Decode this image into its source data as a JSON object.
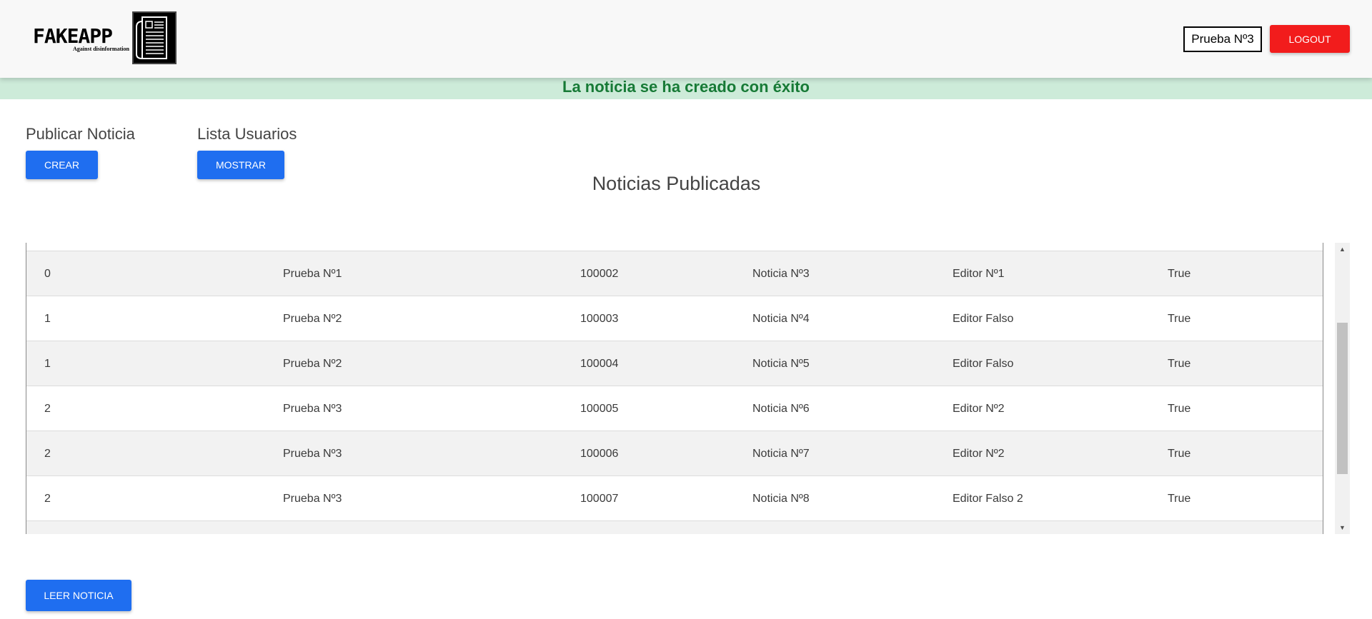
{
  "header": {
    "logo_text": "FAKEAPP",
    "logo_tagline": "Against disinformation",
    "user_name": "Prueba Nº3",
    "logout_label": "LOGOUT"
  },
  "flash_message": "La noticia se ha creado con éxito",
  "publish": {
    "label": "Publicar Noticia",
    "button": "CREAR"
  },
  "users": {
    "label": "Lista Usuarios",
    "button": "MOSTRAR"
  },
  "page_title": "Noticias Publicadas",
  "table": {
    "rows": [
      [
        "0",
        "Prueba Nº1",
        "100002",
        "Noticia Nº3",
        "Editor Nº1",
        "True"
      ],
      [
        "1",
        "Prueba Nº2",
        "100003",
        "Noticia Nº4",
        "Editor Falso",
        "True"
      ],
      [
        "1",
        "Prueba Nº2",
        "100004",
        "Noticia Nº5",
        "Editor Falso",
        "True"
      ],
      [
        "2",
        "Prueba Nº3",
        "100005",
        "Noticia Nº6",
        "Editor Nº2",
        "True"
      ],
      [
        "2",
        "Prueba Nº3",
        "100006",
        "Noticia Nº7",
        "Editor Nº2",
        "True"
      ],
      [
        "2",
        "Prueba Nº3",
        "100007",
        "Noticia Nº8",
        "Editor Falso 2",
        "True"
      ]
    ]
  },
  "read_button": "LEER NOTICIA",
  "colors": {
    "primary": "#1f6ef0",
    "danger": "#f21c1c",
    "success_bg": "#cdebd9",
    "success_text": "#177a36"
  }
}
